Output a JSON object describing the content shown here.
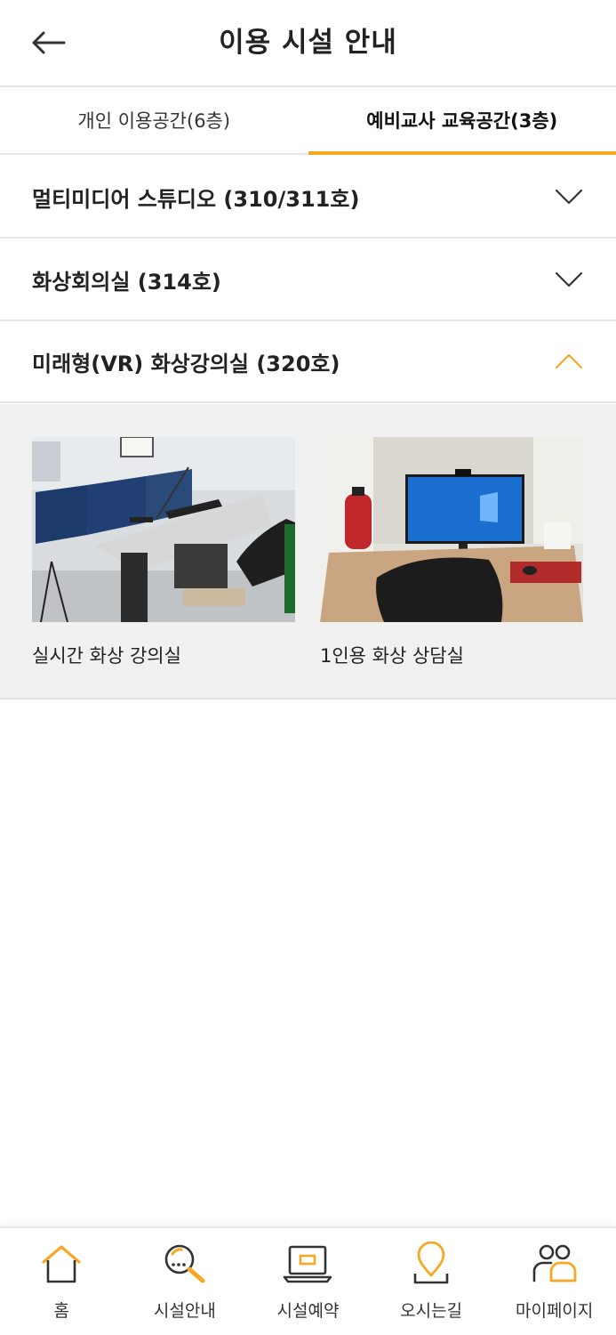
{
  "header": {
    "title": "이용 시설 안내"
  },
  "tabs": [
    {
      "label": "개인 이용공간(6층)",
      "active": false
    },
    {
      "label": "예비교사 교육공간(3층)",
      "active": true
    }
  ],
  "accordion": [
    {
      "title": "멀티미디어 스튜디오 (310/311호)",
      "expanded": false
    },
    {
      "title": "화상회의실 (314호)",
      "expanded": false
    },
    {
      "title": "미래형(VR) 화상강의실 (320호)",
      "expanded": true
    }
  ],
  "rooms": [
    {
      "caption": "실시간 화상 강의실"
    },
    {
      "caption": "1인용 화상 상담실"
    }
  ],
  "colors": {
    "accent": "#f7a823",
    "icon_dark": "#333333"
  },
  "nav": [
    {
      "label": "홈",
      "icon": "home-icon"
    },
    {
      "label": "시설안내",
      "icon": "search-icon"
    },
    {
      "label": "시설예약",
      "icon": "laptop-icon"
    },
    {
      "label": "오시는길",
      "icon": "location-pin-icon"
    },
    {
      "label": "마이페이지",
      "icon": "people-icon"
    }
  ]
}
